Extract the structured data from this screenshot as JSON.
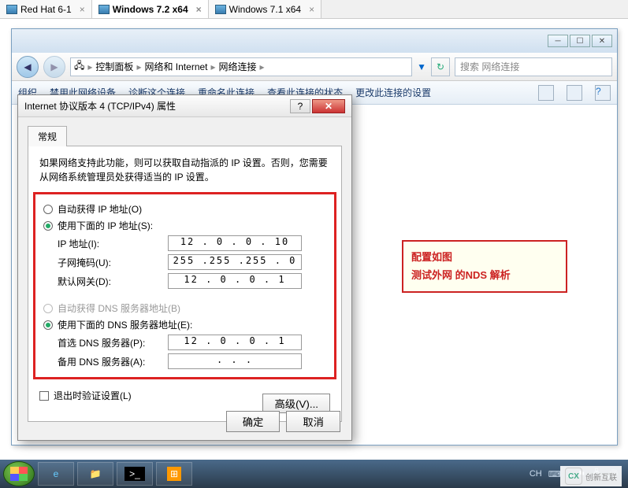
{
  "vm_tabs": [
    {
      "label": "Red Hat 6-1",
      "active": false
    },
    {
      "label": "Windows 7.2 x64",
      "active": true
    },
    {
      "label": "Windows 7.1 x64",
      "active": false
    }
  ],
  "explorer": {
    "breadcrumb": [
      "控制面板",
      "网络和 Internet",
      "网络连接"
    ],
    "search_placeholder": "搜索 网络连接",
    "toolbar": {
      "org": "组织",
      "disable": "禁用此网络设备",
      "diagnose": "诊断这个连接",
      "rename": "重命名此连接",
      "status": "查看此连接的状态",
      "change": "更改此连接的设置"
    }
  },
  "dialog": {
    "title": "Internet 协议版本 4 (TCP/IPv4) 属性",
    "tab": "常规",
    "description": "如果网络支持此功能，则可以获取自动指派的 IP 设置。否则，您需要从网络系统管理员处获得适当的 IP 设置。",
    "auto_ip": "自动获得 IP 地址(O)",
    "use_ip": "使用下面的 IP 地址(S):",
    "ip_label": "IP 地址(I):",
    "ip_value": "12 . 0  . 0  . 10",
    "mask_label": "子网掩码(U):",
    "mask_value": "255 .255 .255 . 0",
    "gw_label": "默认网关(D):",
    "gw_value": "12 . 0  . 0  . 1",
    "auto_dns": "自动获得 DNS 服务器地址(B)",
    "use_dns": "使用下面的 DNS 服务器地址(E):",
    "dns1_label": "首选 DNS 服务器(P):",
    "dns1_value": "12 . 0  . 0  . 1",
    "dns2_label": "备用 DNS 服务器(A):",
    "dns2_value": " .    .    . ",
    "exit_validate": "退出时验证设置(L)",
    "advanced": "高级(V)...",
    "ok": "确定",
    "cancel": "取消"
  },
  "annotation": {
    "line1": "配置如图",
    "line2": "测试外网 的NDS 解析"
  },
  "tray": {
    "ime": "CH",
    "watermark": "创新互联"
  }
}
